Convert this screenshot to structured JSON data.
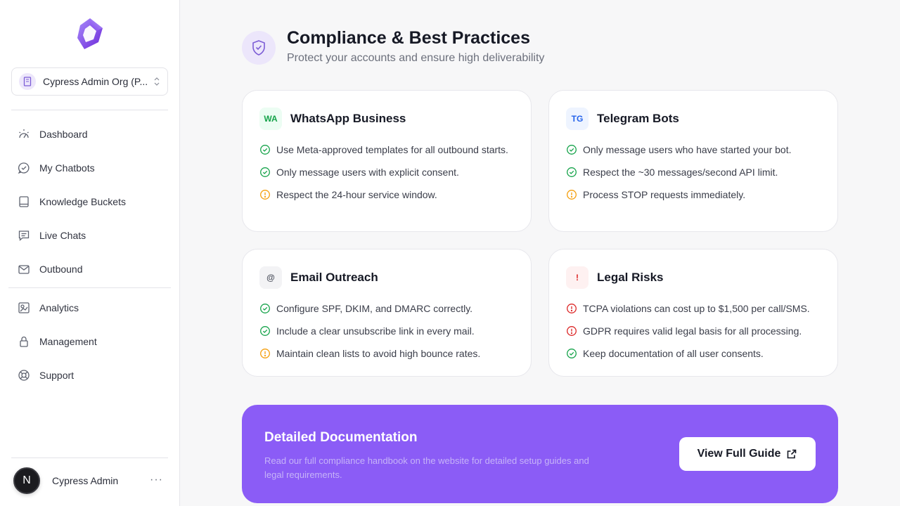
{
  "sidebar": {
    "org": {
      "name": "Cypress Admin Org (P..."
    },
    "nav": [
      {
        "label": "Dashboard",
        "icon": "dashboard-icon"
      },
      {
        "label": "My Chatbots",
        "icon": "chatbot-icon"
      },
      {
        "label": "Knowledge Buckets",
        "icon": "book-icon"
      },
      {
        "label": "Live Chats",
        "icon": "chat-icon"
      },
      {
        "label": "Outbound",
        "icon": "mail-icon"
      },
      {
        "label": "Analytics",
        "icon": "analytics-icon"
      },
      {
        "label": "Management",
        "icon": "lock-icon"
      },
      {
        "label": "Support",
        "icon": "lifebuoy-icon"
      }
    ],
    "user": {
      "avatar_letter": "N",
      "name": "Cypress Admin",
      "more": "···"
    }
  },
  "header": {
    "title": "Compliance & Best Practices",
    "subtitle": "Protect your accounts and ensure high deliverability"
  },
  "cards": [
    {
      "badge": "WA",
      "badge_color": "#16a34a",
      "badge_bg": "#ecfdf3",
      "title": "WhatsApp Business",
      "items": [
        {
          "text": "Use Meta-approved templates for all outbound starts.",
          "status": "ok"
        },
        {
          "text": "Only message users with explicit consent.",
          "status": "ok"
        },
        {
          "text": "Respect the 24-hour service window.",
          "status": "warn"
        }
      ]
    },
    {
      "badge": "TG",
      "badge_color": "#2563eb",
      "badge_bg": "#eef4ff",
      "title": "Telegram Bots",
      "items": [
        {
          "text": "Only message users who have started your bot.",
          "status": "ok"
        },
        {
          "text": "Respect the ~30 messages/second API limit.",
          "status": "ok"
        },
        {
          "text": "Process STOP requests immediately.",
          "status": "warn"
        }
      ]
    },
    {
      "badge": "@",
      "badge_color": "#4b4f5c",
      "badge_bg": "#f3f3f5",
      "title": "Email Outreach",
      "items": [
        {
          "text": "Configure SPF, DKIM, and DMARC correctly.",
          "status": "ok"
        },
        {
          "text": "Include a clear unsubscribe link in every mail.",
          "status": "ok"
        },
        {
          "text": "Maintain clean lists to avoid high bounce rates.",
          "status": "warn"
        }
      ]
    },
    {
      "badge": "!",
      "badge_color": "#dc2626",
      "badge_bg": "#fef1f1",
      "title": "Legal Risks",
      "items": [
        {
          "text": "TCPA violations can cost up to $1,500 per call/SMS.",
          "status": "error"
        },
        {
          "text": "GDPR requires valid legal basis for all processing.",
          "status": "error"
        },
        {
          "text": "Keep documentation of all user consents.",
          "status": "ok"
        }
      ]
    }
  ],
  "doc": {
    "title": "Detailed Documentation",
    "description": "Read our full compliance handbook on the website for detailed setup guides and legal requirements.",
    "button_label": "View Full Guide"
  },
  "colors": {
    "accent": "#8b5cf6",
    "ok": "#16a34a",
    "warn": "#f59e0b",
    "error": "#dc2626"
  }
}
